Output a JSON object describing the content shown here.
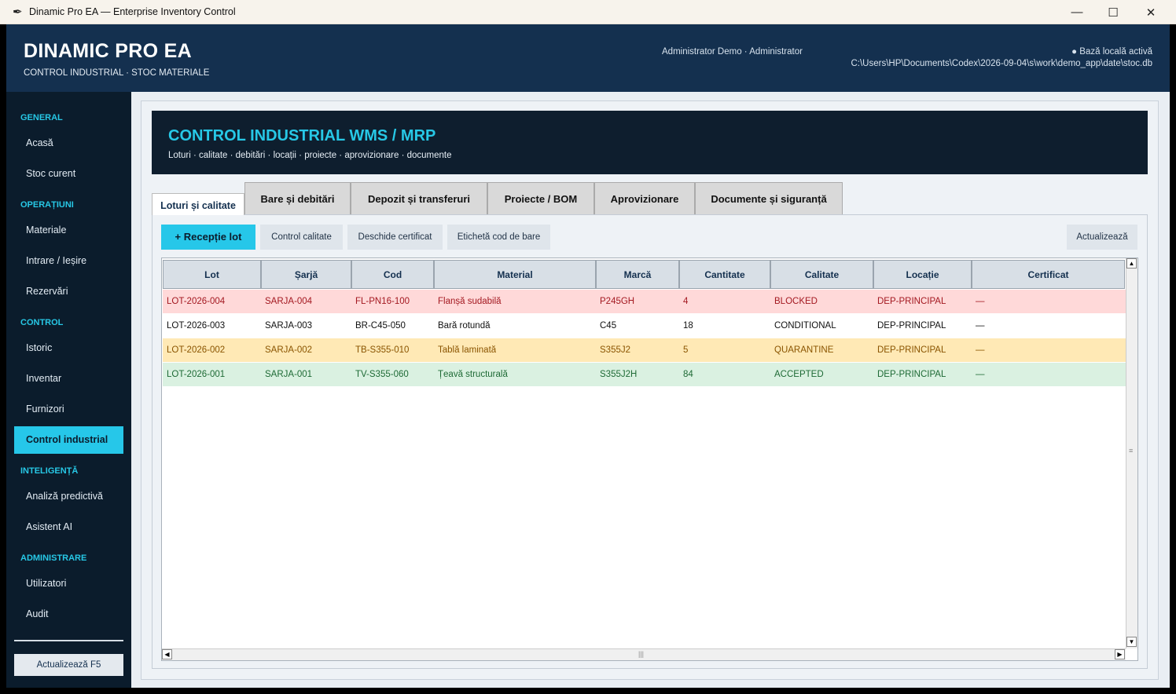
{
  "window": {
    "title": "Dinamic Pro EA — Enterprise Inventory Control",
    "minimize": "—",
    "maximize": "☐",
    "close": "✕"
  },
  "header": {
    "brand": "DINAMIC PRO EA",
    "subtitle": "CONTROL INDUSTRIAL · STOC MATERIALE",
    "user": "Administrator Demo · Administrator",
    "db_status": "●  Bază locală activă",
    "db_path": "C:\\Users\\HP\\Documents\\Codex\\2026-09-04\\s\\work\\demo_app\\date\\stoc.db"
  },
  "sidebar": {
    "sections": {
      "general": "GENERAL",
      "operatiuni": "OPERAȚIUNI",
      "control": "CONTROL",
      "inteligenta": "INTELIGENȚĂ",
      "administrare": "ADMINISTRARE"
    },
    "items": {
      "acasa": "Acasă",
      "stoc_curent": "Stoc curent",
      "materiale": "Materiale",
      "intrare_iesire": "Intrare / Ieșire",
      "rezervari": "Rezervări",
      "istoric": "Istoric",
      "inventar": "Inventar",
      "furnizori": "Furnizori",
      "control_industrial": "Control industrial",
      "analiza_predictiva": "Analiză predictivă",
      "asistent_ai": "Asistent AI",
      "utilizatori": "Utilizatori",
      "audit": "Audit"
    },
    "refresh": "Actualizează  F5"
  },
  "banner": {
    "title": "CONTROL INDUSTRIAL WMS / MRP",
    "subtitle": "Loturi · calitate · debitări · locații · proiecte · aprovizionare · documente"
  },
  "tabs": {
    "loturi": "Loturi și calitate",
    "bare": "Bare și debitări",
    "depozit": "Depozit și transferuri",
    "proiecte": "Proiecte / BOM",
    "aprovizionare": "Aprovizionare",
    "documente": "Documente și siguranță"
  },
  "toolbar": {
    "receptie": "+  Recepție lot",
    "control_calitate": "Control calitate",
    "certificat": "Deschide certificat",
    "eticheta": "Etichetă cod de bare",
    "actualizeaza": "Actualizează"
  },
  "table": {
    "headers": {
      "lot": "Lot",
      "sarja": "Șarjă",
      "cod": "Cod",
      "material": "Material",
      "marca": "Marcă",
      "cantitate": "Cantitate",
      "calitate": "Calitate",
      "locatie": "Locație",
      "certificat": "Certificat"
    },
    "rows": [
      {
        "lot": "LOT-2026-004",
        "sarja": "SARJA-004",
        "cod": "FL-PN16-100",
        "material": "Flanșă sudabilă",
        "marca": "P245GH",
        "cantitate": "4",
        "calitate": "BLOCKED",
        "locatie": "DEP-PRINCIPAL",
        "certificat": "—"
      },
      {
        "lot": "LOT-2026-003",
        "sarja": "SARJA-003",
        "cod": "BR-C45-050",
        "material": "Bară rotundă",
        "marca": "C45",
        "cantitate": "18",
        "calitate": "CONDITIONAL",
        "locatie": "DEP-PRINCIPAL",
        "certificat": "—"
      },
      {
        "lot": "LOT-2026-002",
        "sarja": "SARJA-002",
        "cod": "TB-S355-010",
        "material": "Tablă laminată",
        "marca": "S355J2",
        "cantitate": "5",
        "calitate": "QUARANTINE",
        "locatie": "DEP-PRINCIPAL",
        "certificat": "—"
      },
      {
        "lot": "LOT-2026-001",
        "sarja": "SARJA-001",
        "cod": "TV-S355-060",
        "material": "Țeavă structurală",
        "marca": "S355J2H",
        "cantitate": "84",
        "calitate": "ACCEPTED",
        "locatie": "DEP-PRINCIPAL",
        "certificat": "—"
      }
    ]
  },
  "scroll": {
    "up": "▲",
    "down": "▼",
    "left": "◀",
    "right": "▶",
    "grip_v": "≡",
    "grip_h": "|||"
  },
  "colors": {
    "accent": "#26c7e9",
    "header_bg": "#14304f",
    "sidebar_bg": "#0b1c2c",
    "blocked": "#ffd9d9",
    "quarantine": "#ffe9b5",
    "accepted": "#daf1e1"
  },
  "icons": {
    "app": "feather-icon"
  }
}
